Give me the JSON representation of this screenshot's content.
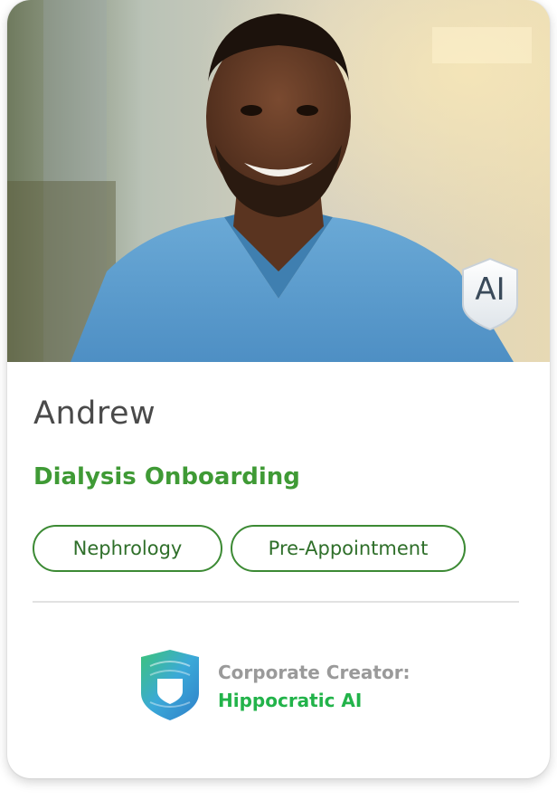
{
  "card": {
    "name": "Andrew",
    "program": "Dialysis Onboarding",
    "tags": [
      "Nephrology",
      "Pre-Appointment"
    ],
    "ai_badge": "AI",
    "creator_label": "Corporate Creator:",
    "creator_name": "Hippocratic AI"
  },
  "colors": {
    "accent_green": "#3f9a35",
    "creator_green": "#22b34a",
    "tag_border": "#3c8a34"
  },
  "icons": {
    "badge": "ai-shield-icon",
    "creator_logo": "shield-logo-icon"
  }
}
